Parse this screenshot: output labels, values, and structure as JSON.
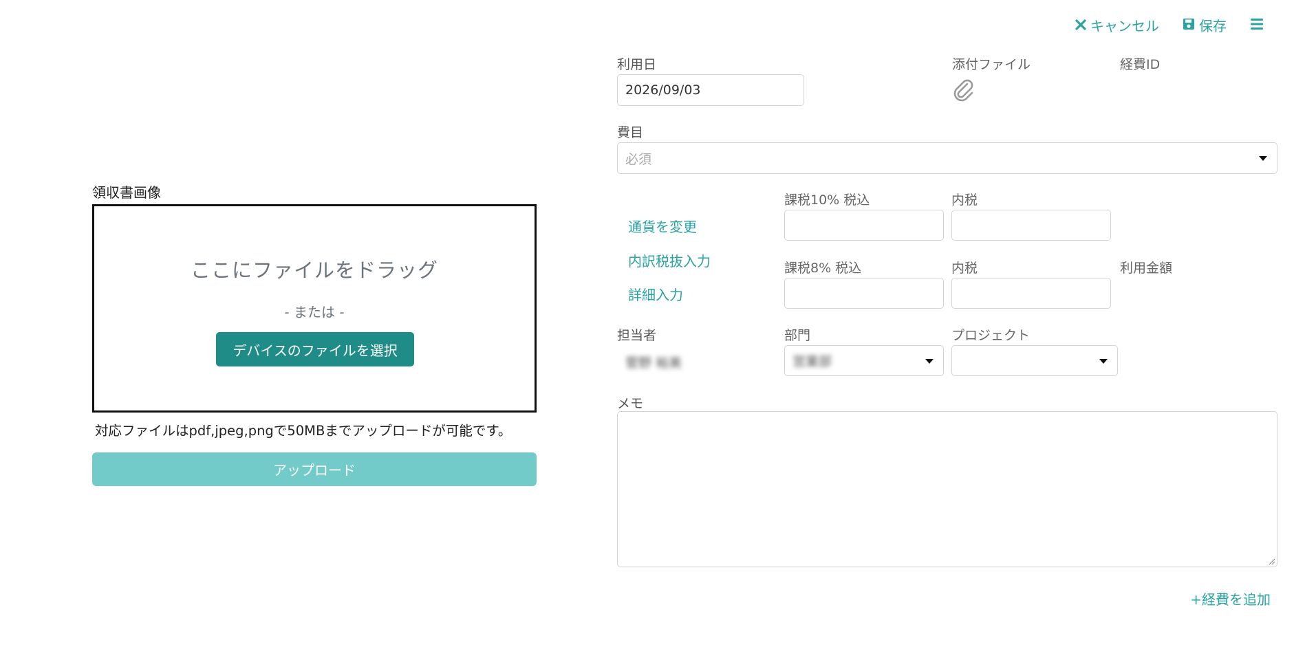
{
  "toolbar": {
    "cancel_label": "キャンセル",
    "save_label": "保存"
  },
  "upload": {
    "title": "領収書画像",
    "drag_text": "ここにファイルをドラッグ",
    "or_text": "- または -",
    "select_button": "デバイスのファイルを選択",
    "support_note": "対応ファイルはpdf,jpeg,pngで50MBまでアップロードが可能です。",
    "upload_button": "アップロード"
  },
  "form": {
    "usage_date_label": "利用日",
    "usage_date_value": "2026/09/03",
    "attachment_label": "添付ファイル",
    "expense_id_label": "経費ID",
    "category_label": "費目",
    "category_placeholder": "必須",
    "change_currency_link": "通貨を変更",
    "tax_excluded_link": "内訳税抜入力",
    "detail_input_link": "詳細入力",
    "tax10_label": "課税10% 税込",
    "tax10_inner_label": "内税",
    "tax8_label": "課税8% 税込",
    "tax8_inner_label": "内税",
    "amount_label": "利用金額",
    "person_label": "担当者",
    "person_value": "菅野 裕美",
    "department_label": "部門",
    "department_value": "営業部",
    "project_label": "プロジェクト",
    "memo_label": "メモ",
    "add_expense": "+経費を追加"
  },
  "colors": {
    "accent": "#2aa3a3",
    "button_dark": "#1f8c88",
    "button_disabled": "#72cbc9"
  }
}
